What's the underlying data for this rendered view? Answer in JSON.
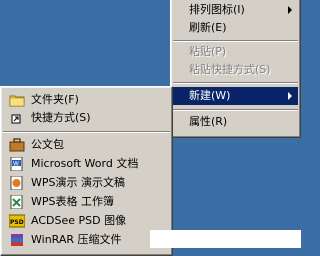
{
  "context_menu": {
    "items": [
      {
        "label": "排列图标(I)",
        "submenu": true,
        "disabled": false
      },
      {
        "label": "刷新(E)",
        "submenu": false,
        "disabled": false
      },
      {
        "label": "粘贴(P)",
        "submenu": false,
        "disabled": true
      },
      {
        "label": "粘贴快捷方式(S)",
        "submenu": false,
        "disabled": true
      },
      {
        "label": "新建(W)",
        "submenu": true,
        "disabled": false,
        "highlighted": true
      },
      {
        "label": "属性(R)",
        "submenu": false,
        "disabled": false
      }
    ]
  },
  "new_submenu": {
    "items": [
      {
        "label": "文件夹(F)",
        "icon": "folder-icon"
      },
      {
        "label": "快捷方式(S)",
        "icon": "shortcut-icon"
      },
      {
        "label": "公文包",
        "icon": "briefcase-icon"
      },
      {
        "label": "Microsoft Word 文档",
        "icon": "word-document-icon"
      },
      {
        "label": "WPS演示 演示文稿",
        "icon": "wps-presentation-icon"
      },
      {
        "label": "WPS表格 工作簿",
        "icon": "wps-spreadsheet-icon"
      },
      {
        "label": "ACDSee PSD 图像",
        "icon": "psd-image-icon"
      },
      {
        "label": "WinRAR 压缩文件",
        "icon": "winrar-archive-icon"
      }
    ]
  },
  "colors": {
    "desktop": "#3a6ea5",
    "menu": "#d4d0c8",
    "highlight": "#0a246a"
  }
}
